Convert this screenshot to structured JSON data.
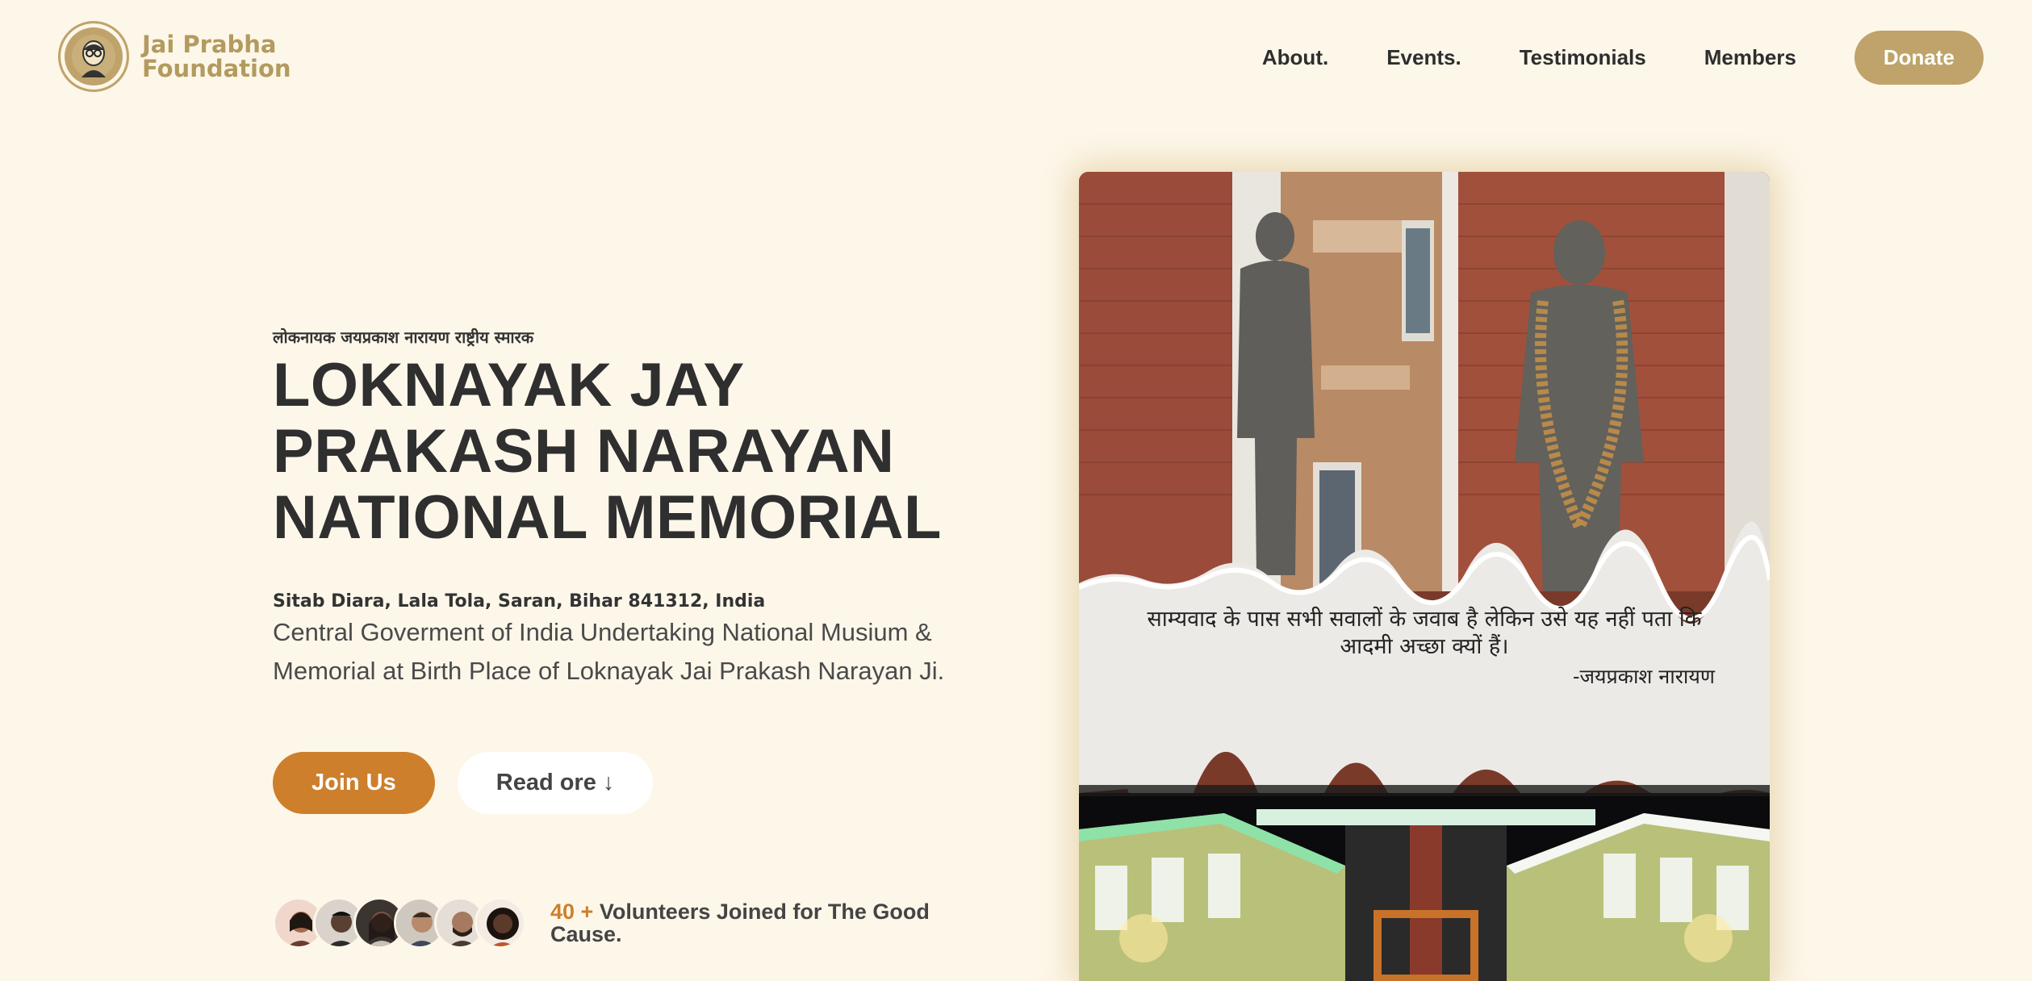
{
  "header": {
    "logo_line1": "Jai Prabha",
    "logo_line2": "Foundation",
    "nav": [
      "About.",
      "Events.",
      "Testimonials",
      "Members"
    ],
    "donate_label": "Donate"
  },
  "hero": {
    "eyebrow": "लोकनायक जयप्रकाश नारायण राष्ट्रीय स्मारक",
    "title_lines": [
      "LOKNAYAK JAY",
      "PRAKASH NARAYAN",
      "NATIONAL MEMORIAL"
    ],
    "address": "Sitab Diara, Lala Tola, Saran, Bihar 841312, India",
    "description": "Central Goverment of India Undertaking National Musium & Memorial at Birth Place of Loknayak Jai Prakash Narayan Ji.",
    "join_label": "Join Us",
    "read_label": "Read ore ↓"
  },
  "volunteers": {
    "count": "40 +",
    "text": "Volunteers Joined for The Good Cause.",
    "avatar_colors": [
      "#e9b8a8",
      "#5a4032",
      "#7a5444",
      "#8c6b55",
      "#4b3a30",
      "#3b2a22"
    ]
  },
  "card": {
    "quote": "साम्यवाद के पास सभी सवालों के जवाब है लेकिन उसे यह नहीं पता कि आदमी अच्छा क्यों हैं।",
    "quote_author": "-जयप्रकाश नारायण"
  },
  "colors": {
    "background": "#fdf7ea",
    "gold": "#bfa36a",
    "accent_orange": "#cd7f2c",
    "text_dark": "#2f2f2f"
  }
}
